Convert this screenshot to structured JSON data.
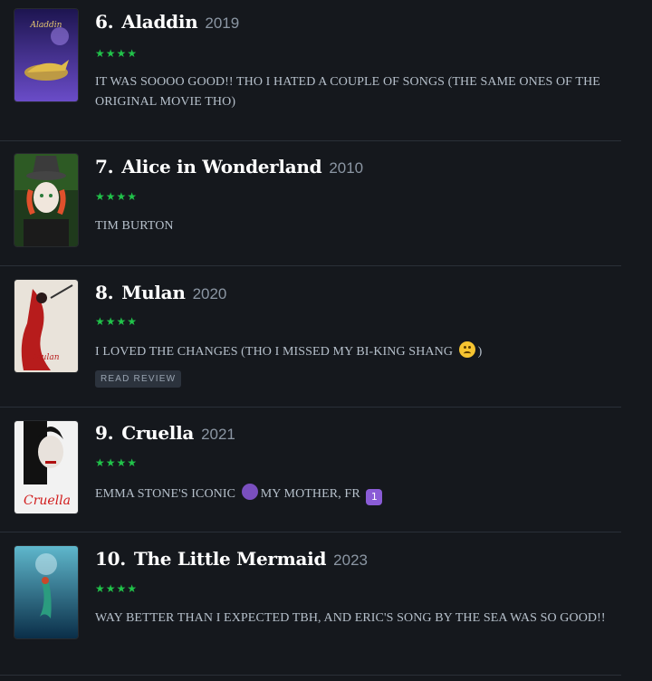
{
  "entries": [
    {
      "rank": "6.",
      "title": "Aladdin",
      "year": "2019",
      "stars": "★★★★",
      "review": "IT WAS SOOOO GOOD!! THO I HATED A COUPLE OF SONGS (THE SAME ONES OF THE ORIGINAL MOVIE THO)",
      "poster_text": "Aladdin",
      "colors": [
        "#2a1f6b",
        "#7b5ad6"
      ]
    },
    {
      "rank": "7.",
      "title": "Alice in Wonderland",
      "year": "2010",
      "stars": "★★★★",
      "review": "TIM BURTON",
      "poster_text": "",
      "colors": [
        "#1e3b1a",
        "#c2352a"
      ]
    },
    {
      "rank": "8.",
      "title": "Mulan",
      "year": "2020",
      "stars": "★★★★",
      "review_before": "I LOVED THE CHANGES (THO I MISSED MY BI-KING SHANG",
      "review_after": ")",
      "emoji": "frowning-face",
      "button": "READ REVIEW",
      "poster_text": "Mulan",
      "colors": [
        "#e9e4dc",
        "#b71c1c"
      ]
    },
    {
      "rank": "9.",
      "title": "Cruella",
      "year": "2021",
      "stars": "★★★★",
      "review_before": "EMMA STONE'S ICONIC",
      "review_middle": "MY MOTHER, FR",
      "review_after": "",
      "emoji1": "fairy",
      "emoji2": "1",
      "poster_text": "Cruella",
      "colors": [
        "#f3f3f3",
        "#d11a1a"
      ]
    },
    {
      "rank": "10.",
      "title": "The Little Mermaid",
      "year": "2023",
      "stars": "★★★★",
      "review": "WAY BETTER THAN I EXPECTED TBH, AND ERIC'S SONG BY THE SEA WAS SO GOOD!!",
      "poster_text": "",
      "colors": [
        "#0f3f5c",
        "#4fb3c9"
      ]
    }
  ]
}
